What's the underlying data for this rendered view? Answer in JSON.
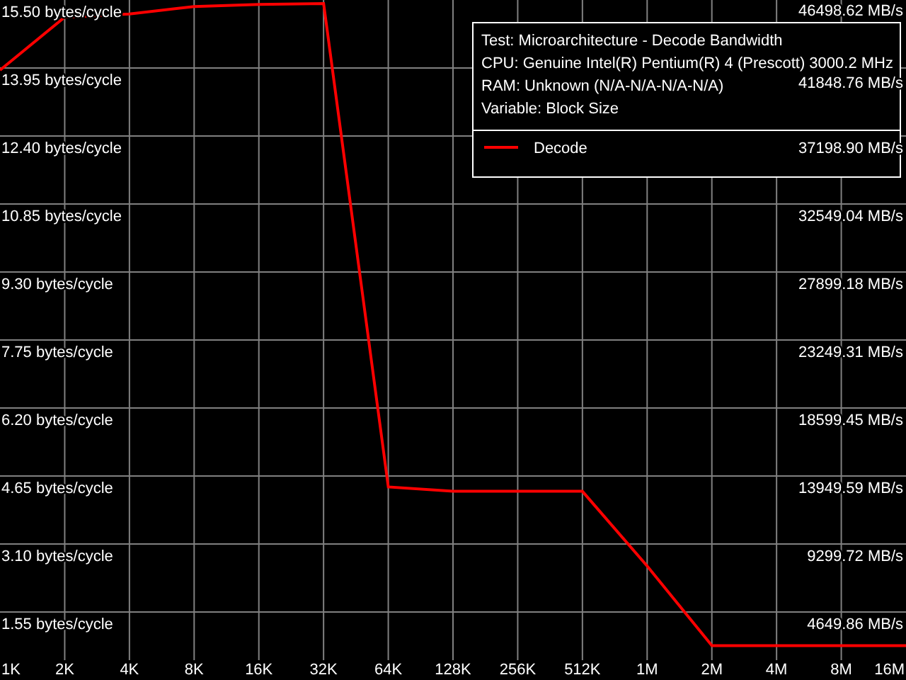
{
  "chart": {
    "chart_data": {
      "type": "line",
      "categories": [
        "1K",
        "2K",
        "4K",
        "8K",
        "16K",
        "32K",
        "64K",
        "128K",
        "256K",
        "512K",
        "1M",
        "2M",
        "4M",
        "8M",
        "16M"
      ],
      "series": [
        {
          "name": "Decode",
          "color": "#ff0000",
          "values": [
            13.9,
            15.11,
            15.18,
            15.35,
            15.4,
            15.42,
            4.4,
            4.3,
            4.3,
            4.3,
            2.6,
            0.78,
            0.78,
            0.78,
            0.78
          ]
        }
      ],
      "ylim": [
        0,
        15.5
      ],
      "grid": true,
      "yticks": [
        {
          "value": 15.5,
          "label": "15.50 bytes/cycle"
        },
        {
          "value": 13.95,
          "label": "13.95 bytes/cycle"
        },
        {
          "value": 12.4,
          "label": "12.40 bytes/cycle"
        },
        {
          "value": 10.85,
          "label": "10.85 bytes/cycle"
        },
        {
          "value": 9.3,
          "label": "9.30 bytes/cycle"
        },
        {
          "value": 7.75,
          "label": "7.75 bytes/cycle"
        },
        {
          "value": 6.2,
          "label": "6.20 bytes/cycle"
        },
        {
          "value": 4.65,
          "label": "4.65 bytes/cycle"
        },
        {
          "value": 3.1,
          "label": "3.10 bytes/cycle"
        },
        {
          "value": 1.55,
          "label": "1.55 bytes/cycle"
        }
      ]
    },
    "right_axis_labels": [
      "46498.62 MB/s",
      "41848.76 MB/s",
      "37198.90 MB/s",
      "32549.04 MB/s",
      "27899.18 MB/s",
      "23249.31 MB/s",
      "18599.45 MB/s",
      "13949.59 MB/s",
      "9299.72 MB/s",
      "4649.86 MB/s"
    ],
    "info_lines": [
      "Test: Microarchitecture - Decode Bandwidth",
      "CPU: Genuine Intel(R) Pentium(R) 4 (Prescott) 3000.2 MHz",
      "RAM: Unknown (N/A-N/A-N/A-N/A)",
      "Variable: Block Size"
    ]
  }
}
